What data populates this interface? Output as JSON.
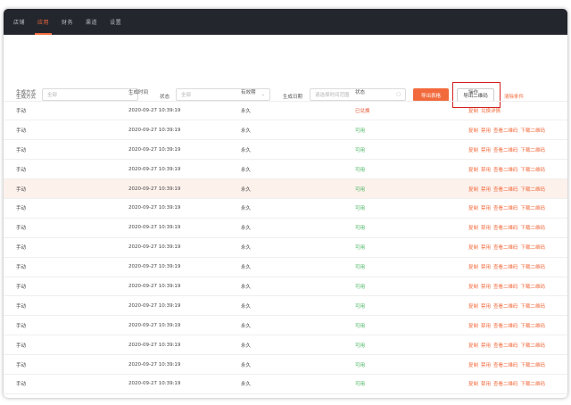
{
  "nav": {
    "items": [
      {
        "label": "店铺",
        "active": false
      },
      {
        "label": "应用",
        "active": true
      },
      {
        "label": "财务",
        "active": false
      },
      {
        "label": "渠道",
        "active": false
      },
      {
        "label": "设置",
        "active": false
      }
    ]
  },
  "filters": {
    "method_label": "生成方式",
    "method_value": "全部",
    "status_label": "状态",
    "status_value": "全部",
    "date_label": "生成日期",
    "date_placeholder": "请选择时间范围",
    "export_table": "导出表格",
    "export_qr": "导出二维码",
    "clear": "清除条件"
  },
  "table": {
    "headers": [
      "生成方式",
      "生成时间",
      "有效期",
      "状态",
      "操作"
    ],
    "rows": [
      {
        "method": "手动",
        "time": "2020-09-27 10:39:19",
        "validity": "永久",
        "status": "已兑换",
        "status_type": "off",
        "ops": [
          "复制",
          "兑换详情"
        ]
      },
      {
        "method": "手动",
        "time": "2020-09-27 10:39:19",
        "validity": "永久",
        "status": "可用",
        "status_type": "on",
        "ops": [
          "复制",
          "禁用",
          "查看二维码",
          "下载二维码"
        ]
      },
      {
        "method": "手动",
        "time": "2020-09-27 10:39:19",
        "validity": "永久",
        "status": "可用",
        "status_type": "on",
        "ops": [
          "复制",
          "禁用",
          "查看二维码",
          "下载二维码"
        ]
      },
      {
        "method": "手动",
        "time": "2020-09-27 10:39:19",
        "validity": "永久",
        "status": "可用",
        "status_type": "on",
        "ops": [
          "复制",
          "禁用",
          "查看二维码",
          "下载二维码"
        ]
      },
      {
        "method": "手动",
        "time": "2020-09-27 10:39:19",
        "validity": "永久",
        "status": "可用",
        "status_type": "on",
        "highlight": true,
        "ops": [
          "复制",
          "禁用",
          "查看二维码",
          "下载二维码"
        ]
      },
      {
        "method": "手动",
        "time": "2020-09-27 10:39:19",
        "validity": "永久",
        "status": "可用",
        "status_type": "on",
        "ops": [
          "复制",
          "禁用",
          "查看二维码",
          "下载二维码"
        ]
      },
      {
        "method": "手动",
        "time": "2020-09-27 10:39:19",
        "validity": "永久",
        "status": "可用",
        "status_type": "on",
        "ops": [
          "复制",
          "禁用",
          "查看二维码",
          "下载二维码"
        ]
      },
      {
        "method": "手动",
        "time": "2020-09-27 10:39:19",
        "validity": "永久",
        "status": "可用",
        "status_type": "on",
        "ops": [
          "复制",
          "禁用",
          "查看二维码",
          "下载二维码"
        ]
      },
      {
        "method": "手动",
        "time": "2020-09-27 10:39:19",
        "validity": "永久",
        "status": "可用",
        "status_type": "on",
        "ops": [
          "复制",
          "禁用",
          "查看二维码",
          "下载二维码"
        ]
      },
      {
        "method": "手动",
        "time": "2020-09-27 10:39:19",
        "validity": "永久",
        "status": "可用",
        "status_type": "on",
        "ops": [
          "复制",
          "禁用",
          "查看二维码",
          "下载二维码"
        ]
      },
      {
        "method": "手动",
        "time": "2020-09-27 10:39:19",
        "validity": "永久",
        "status": "可用",
        "status_type": "on",
        "ops": [
          "复制",
          "禁用",
          "查看二维码",
          "下载二维码"
        ]
      },
      {
        "method": "手动",
        "time": "2020-09-27 10:39:19",
        "validity": "永久",
        "status": "可用",
        "status_type": "on",
        "ops": [
          "复制",
          "禁用",
          "查看二维码",
          "下载二维码"
        ]
      },
      {
        "method": "手动",
        "time": "2020-09-27 10:39:19",
        "validity": "永久",
        "status": "可用",
        "status_type": "on",
        "ops": [
          "复制",
          "禁用",
          "查看二维码",
          "下载二维码"
        ]
      },
      {
        "method": "手动",
        "time": "2020-09-27 10:39:19",
        "validity": "永久",
        "status": "可用",
        "status_type": "on",
        "ops": [
          "复制",
          "禁用",
          "查看二维码",
          "下载二维码"
        ]
      },
      {
        "method": "手动",
        "time": "2020-09-27 10:39:19",
        "validity": "永久",
        "status": "可用",
        "status_type": "on",
        "ops": [
          "复制",
          "禁用",
          "查看二维码",
          "下载二维码"
        ]
      }
    ]
  },
  "colors": {
    "accent": "#f26a3c",
    "nav_bg": "#24262e",
    "status_on": "#43b35c",
    "status_off": "#e8502f",
    "highlight_row": "#fdf1ec",
    "annotation_box": "#d32020"
  }
}
